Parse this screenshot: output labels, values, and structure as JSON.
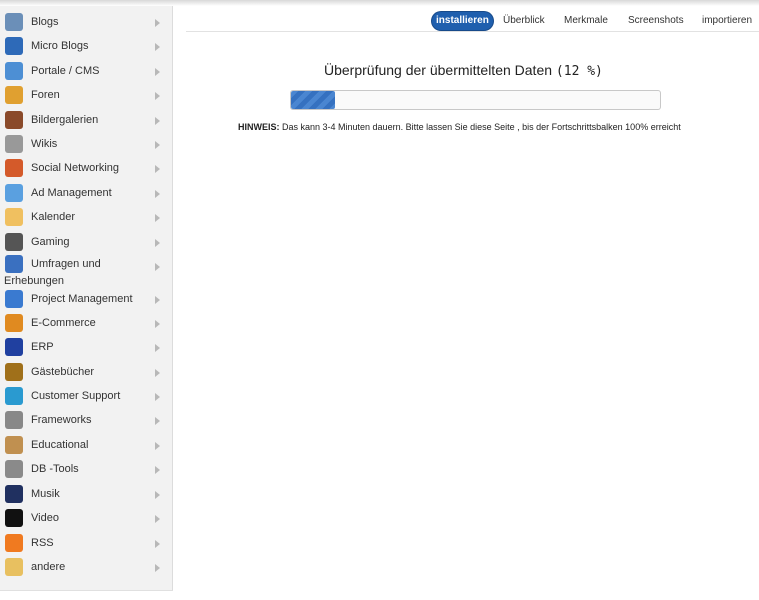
{
  "sidebar": {
    "items": [
      {
        "label": "Blogs",
        "icon": "user-icon",
        "color": "#6b8fb8"
      },
      {
        "label": "Micro Blogs",
        "icon": "micro-blogs-icon",
        "color": "#2e6ab8"
      },
      {
        "label": "Portale / CMS",
        "icon": "window-icon",
        "color": "#4d8fd4"
      },
      {
        "label": "Foren",
        "icon": "forum-icon",
        "color": "#e0a030"
      },
      {
        "label": "Bildergalerien",
        "icon": "gallery-icon",
        "color": "#8a4a2a"
      },
      {
        "label": "Wikis",
        "icon": "puzzle-globe-icon",
        "color": "#999999"
      },
      {
        "label": "Social Networking",
        "icon": "people-icon",
        "color": "#d45a2a"
      },
      {
        "label": "Ad Management",
        "icon": "ad-arrow-icon",
        "color": "#5aa0e0"
      },
      {
        "label": "Kalender",
        "icon": "calendar-icon",
        "color": "#f0c060"
      },
      {
        "label": "Gaming",
        "icon": "gamepad-icon",
        "color": "#555555"
      },
      {
        "label": "Umfragen und",
        "label2": "Erhebungen",
        "icon": "pie-chart-icon",
        "color": "#3a70c0"
      },
      {
        "label": "Project Management",
        "icon": "list-icon",
        "color": "#3a7ad0"
      },
      {
        "label": "E-Commerce",
        "icon": "cart-icon",
        "color": "#e08a20"
      },
      {
        "label": "ERP",
        "icon": "bar-chart-icon",
        "color": "#2040a0"
      },
      {
        "label": "Gästebücher",
        "icon": "book-icon",
        "color": "#a0701a"
      },
      {
        "label": "Customer Support",
        "icon": "chat-bubbles-icon",
        "color": "#2a9ad0"
      },
      {
        "label": "Frameworks",
        "icon": "gears-icon",
        "color": "#888888"
      },
      {
        "label": "Educational",
        "icon": "open-book-icon",
        "color": "#c09050"
      },
      {
        "label": "DB -Tools",
        "icon": "database-icon",
        "color": "#8a8a8a"
      },
      {
        "label": "Musik",
        "icon": "music-icon",
        "color": "#203060"
      },
      {
        "label": "Video",
        "icon": "clapperboard-icon",
        "color": "#111111"
      },
      {
        "label": "RSS",
        "icon": "rss-icon",
        "color": "#f07a20"
      },
      {
        "label": "andere",
        "icon": "folder-icon",
        "color": "#e8c060"
      }
    ]
  },
  "tabs": [
    {
      "label": "installieren",
      "active": true
    },
    {
      "label": "Überblick",
      "active": false
    },
    {
      "label": "Merkmale",
      "active": false
    },
    {
      "label": "Screenshots",
      "active": false
    },
    {
      "label": "importieren",
      "active": false
    }
  ],
  "main": {
    "title": "Überprüfung der übermittelten Daten",
    "percent_text": "(12 %)",
    "progress": 0.12,
    "hint_bold": "HINWEIS:",
    "hint_text": " Das kann 3-4 Minuten dauern. Bitte lassen Sie diese Seite , bis der Fortschrittsbalken 100% erreicht"
  },
  "colors": {
    "active_tab": "#1f5fae",
    "progress_fill": "#3571c0"
  }
}
